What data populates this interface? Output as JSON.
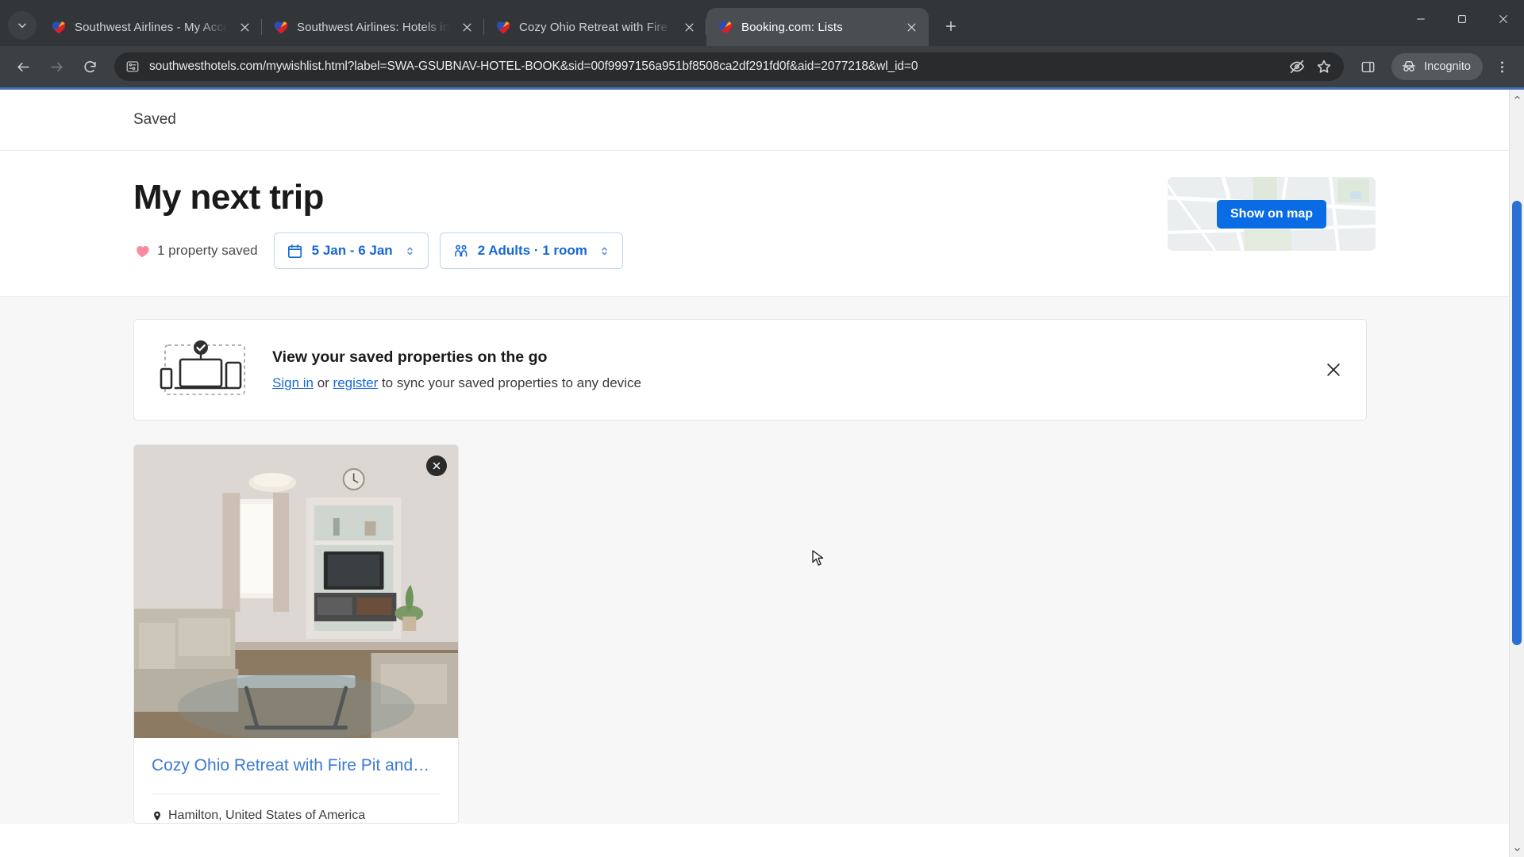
{
  "browser": {
    "tab_search_icon": "chevron-down-icon",
    "tabs": [
      {
        "title": "Southwest Airlines - My Account",
        "favicon": "southwest-heart-icon",
        "active": false
      },
      {
        "title": "Southwest Airlines: Hotels in Ha",
        "favicon": "southwest-heart-icon",
        "active": false
      },
      {
        "title": "Cozy Ohio Retreat with Fire Pit",
        "favicon": "southwest-heart-icon",
        "active": false
      },
      {
        "title": "Booking.com: Lists",
        "favicon": "southwest-heart-icon",
        "active": true
      }
    ],
    "new_tab_label": "+",
    "window_controls": {
      "minimize": "minimize-icon",
      "maximize": "maximize-icon",
      "close": "close-icon"
    },
    "nav": {
      "back": "back-arrow-icon",
      "forward": "forward-arrow-icon",
      "reload": "reload-icon"
    },
    "omnibox": {
      "site_info_icon": "site-settings-icon",
      "url": "southwesthotels.com/mywishlist.html?label=SWA-GSUBNAV-HOTEL-BOOK&sid=00f9997156a951bf8508ca2df291fd0f&aid=2077218&wl_id=0",
      "tracking_icon": "eye-slash-icon",
      "bookmark_icon": "star-icon"
    },
    "side_panel_icon": "side-panel-icon",
    "incognito_label": "Incognito",
    "incognito_icon": "incognito-icon",
    "menu_icon": "three-dot-menu-icon"
  },
  "page": {
    "breadcrumb": "Saved",
    "hero": {
      "title": "My next trip",
      "saved_count": "1 property saved",
      "heart_icon": "heart-icon",
      "date_pill": {
        "icon": "calendar-icon",
        "value": "5 Jan - 6 Jan",
        "chevron": "updown-chevron-icon"
      },
      "guests_pill": {
        "icon": "guests-icon",
        "value": "2 Adults · 1 room",
        "chevron": "updown-chevron-icon"
      },
      "map": {
        "button_label": "Show on map",
        "accent": "#0a6ce4"
      }
    },
    "banner": {
      "art_icon": "devices-sync-icon",
      "title": "View your saved properties on the go",
      "sub_prefix": "",
      "sign_in_label": "Sign in",
      "between_label": " or ",
      "register_label": "register",
      "sub_suffix": " to sync your saved properties to any device",
      "close_icon": "close-icon"
    },
    "properties": [
      {
        "title": "Cozy Ohio Retreat with Fire Pit and…",
        "location": "Hamilton, United States of America",
        "location_icon": "map-pin-icon",
        "remove_icon": "remove-close-icon",
        "photo_alt": "living-room-photo"
      }
    ],
    "scrollbar": {
      "up_icon": "chevron-up-icon",
      "down_icon": "chevron-down-icon"
    }
  },
  "colors": {
    "brand_blue": "#1668d6",
    "button_blue": "#0a6ce4",
    "heart_pink": "#fc8ba0",
    "chrome_dark": "#3c4043"
  }
}
